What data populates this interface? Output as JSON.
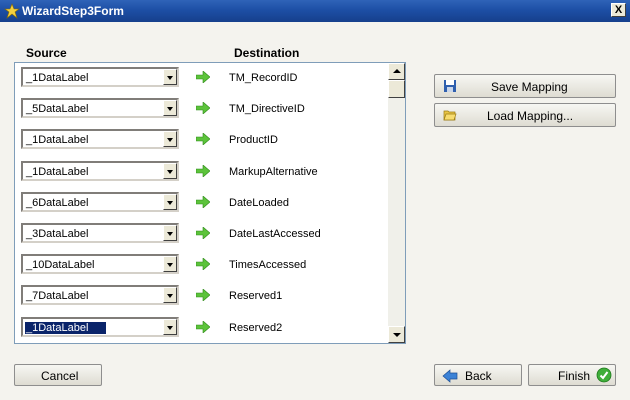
{
  "window": {
    "title": "WizardStep3Form",
    "close_label": "X"
  },
  "columns": {
    "source": "Source",
    "destination": "Destination"
  },
  "rows": [
    {
      "source": "_1DataLabel",
      "destination": "TM_RecordID"
    },
    {
      "source": "_5DataLabel",
      "destination": "TM_DirectiveID"
    },
    {
      "source": "_1DataLabel",
      "destination": "ProductID"
    },
    {
      "source": "_1DataLabel",
      "destination": "MarkupAlternative"
    },
    {
      "source": "_6DataLabel",
      "destination": "DateLoaded"
    },
    {
      "source": "_3DataLabel",
      "destination": "DateLastAccessed"
    },
    {
      "source": "_10DataLabel",
      "destination": "TimesAccessed"
    },
    {
      "source": "_7DataLabel",
      "destination": "Reserved1"
    },
    {
      "source": "_1DataLabel",
      "destination": "Reserved2",
      "selected": true
    }
  ],
  "buttons": {
    "save_mapping": "Save Mapping",
    "load_mapping": "Load Mapping...",
    "cancel": "Cancel",
    "back": "Back",
    "finish": "Finish"
  },
  "icons": {
    "row_arrow": "green-right-arrow-icon",
    "save": "floppy-disk-icon",
    "load": "open-folder-icon",
    "back": "blue-left-arrow-icon",
    "finish": "green-check-icon"
  },
  "colors": {
    "titlebar": "#1d4fa5",
    "selection": "#0a246a",
    "arrow": "#5cc33b"
  }
}
